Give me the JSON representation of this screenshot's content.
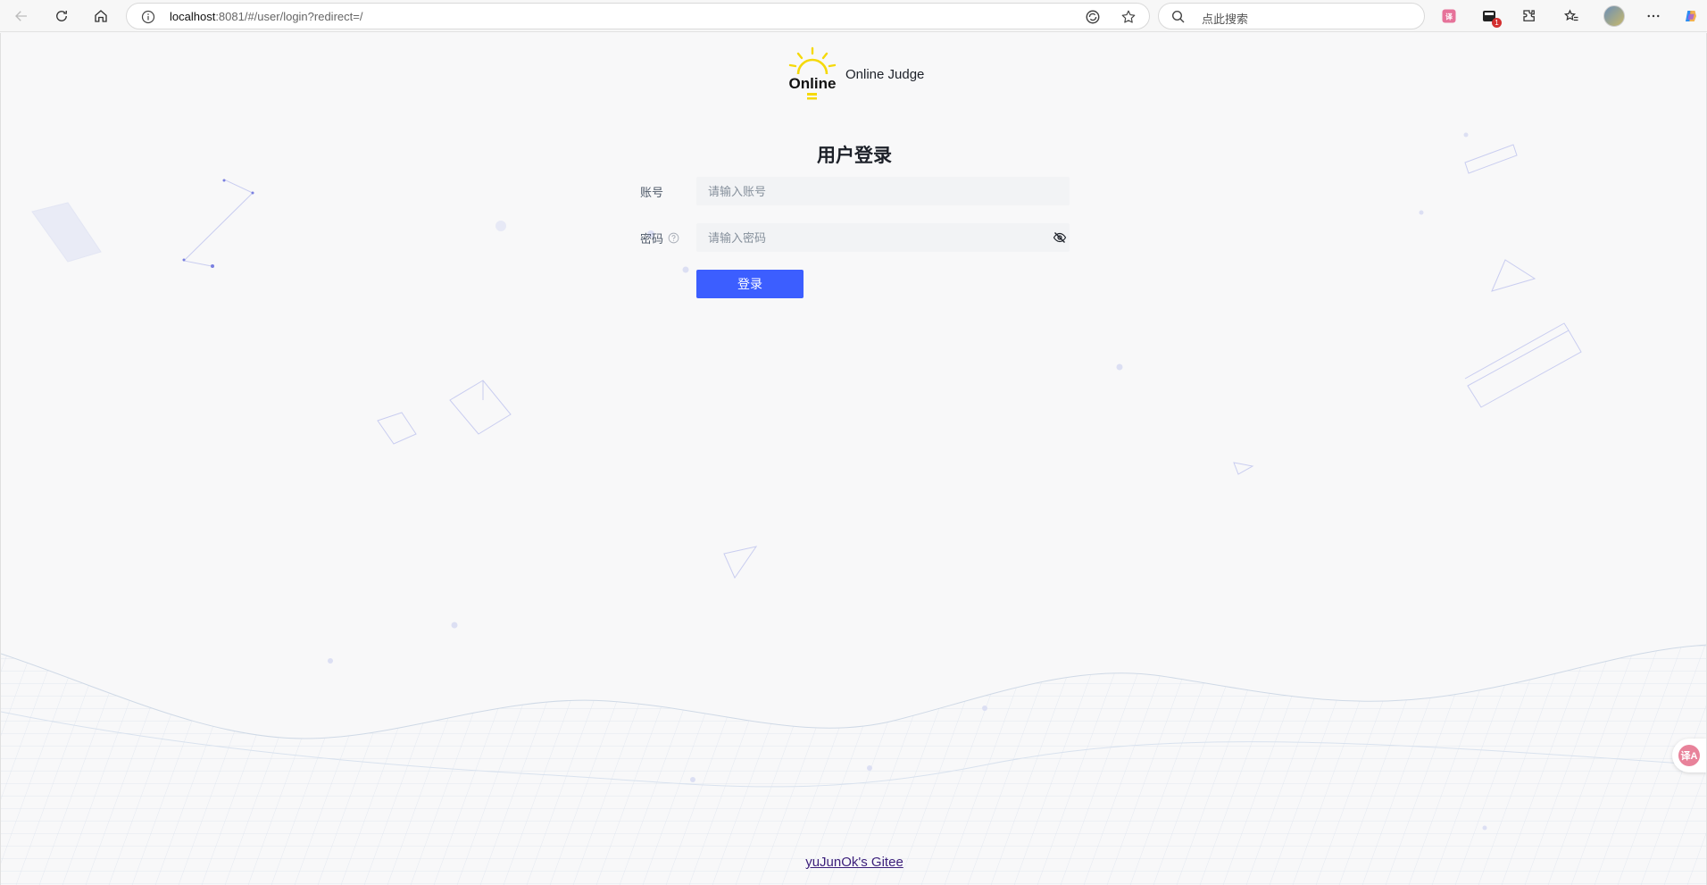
{
  "browser": {
    "url_host": "localhost",
    "url_rest": ":8081/#/user/login?redirect=/",
    "search_placeholder": "点此搜索",
    "extension_badge": "1",
    "translate_glyph": "译A"
  },
  "header": {
    "logo_text": "Online",
    "site_name": "Online Judge"
  },
  "login": {
    "title": "用户登录",
    "account_label": "账号",
    "account_placeholder": "请输入账号",
    "password_label": "密码",
    "password_placeholder": "请输入密码",
    "submit_label": "登录"
  },
  "footer": {
    "link_text": "yuJunOk's Gitee"
  },
  "colors": {
    "primary": "#3c5eff",
    "input_bg": "#f2f3f5",
    "logo_yellow": "#f5d90a",
    "footer_link": "#3b1e7a"
  },
  "icons": [
    "back-icon",
    "refresh-icon",
    "home-icon",
    "info-icon",
    "read-aloud-icon",
    "favorite-star-icon",
    "search-icon",
    "translate-icon",
    "extension-icon",
    "puzzle-icon",
    "favorites-icon",
    "avatar",
    "more-icon",
    "copilot-icon",
    "help-circle-icon",
    "eye-off-icon"
  ]
}
